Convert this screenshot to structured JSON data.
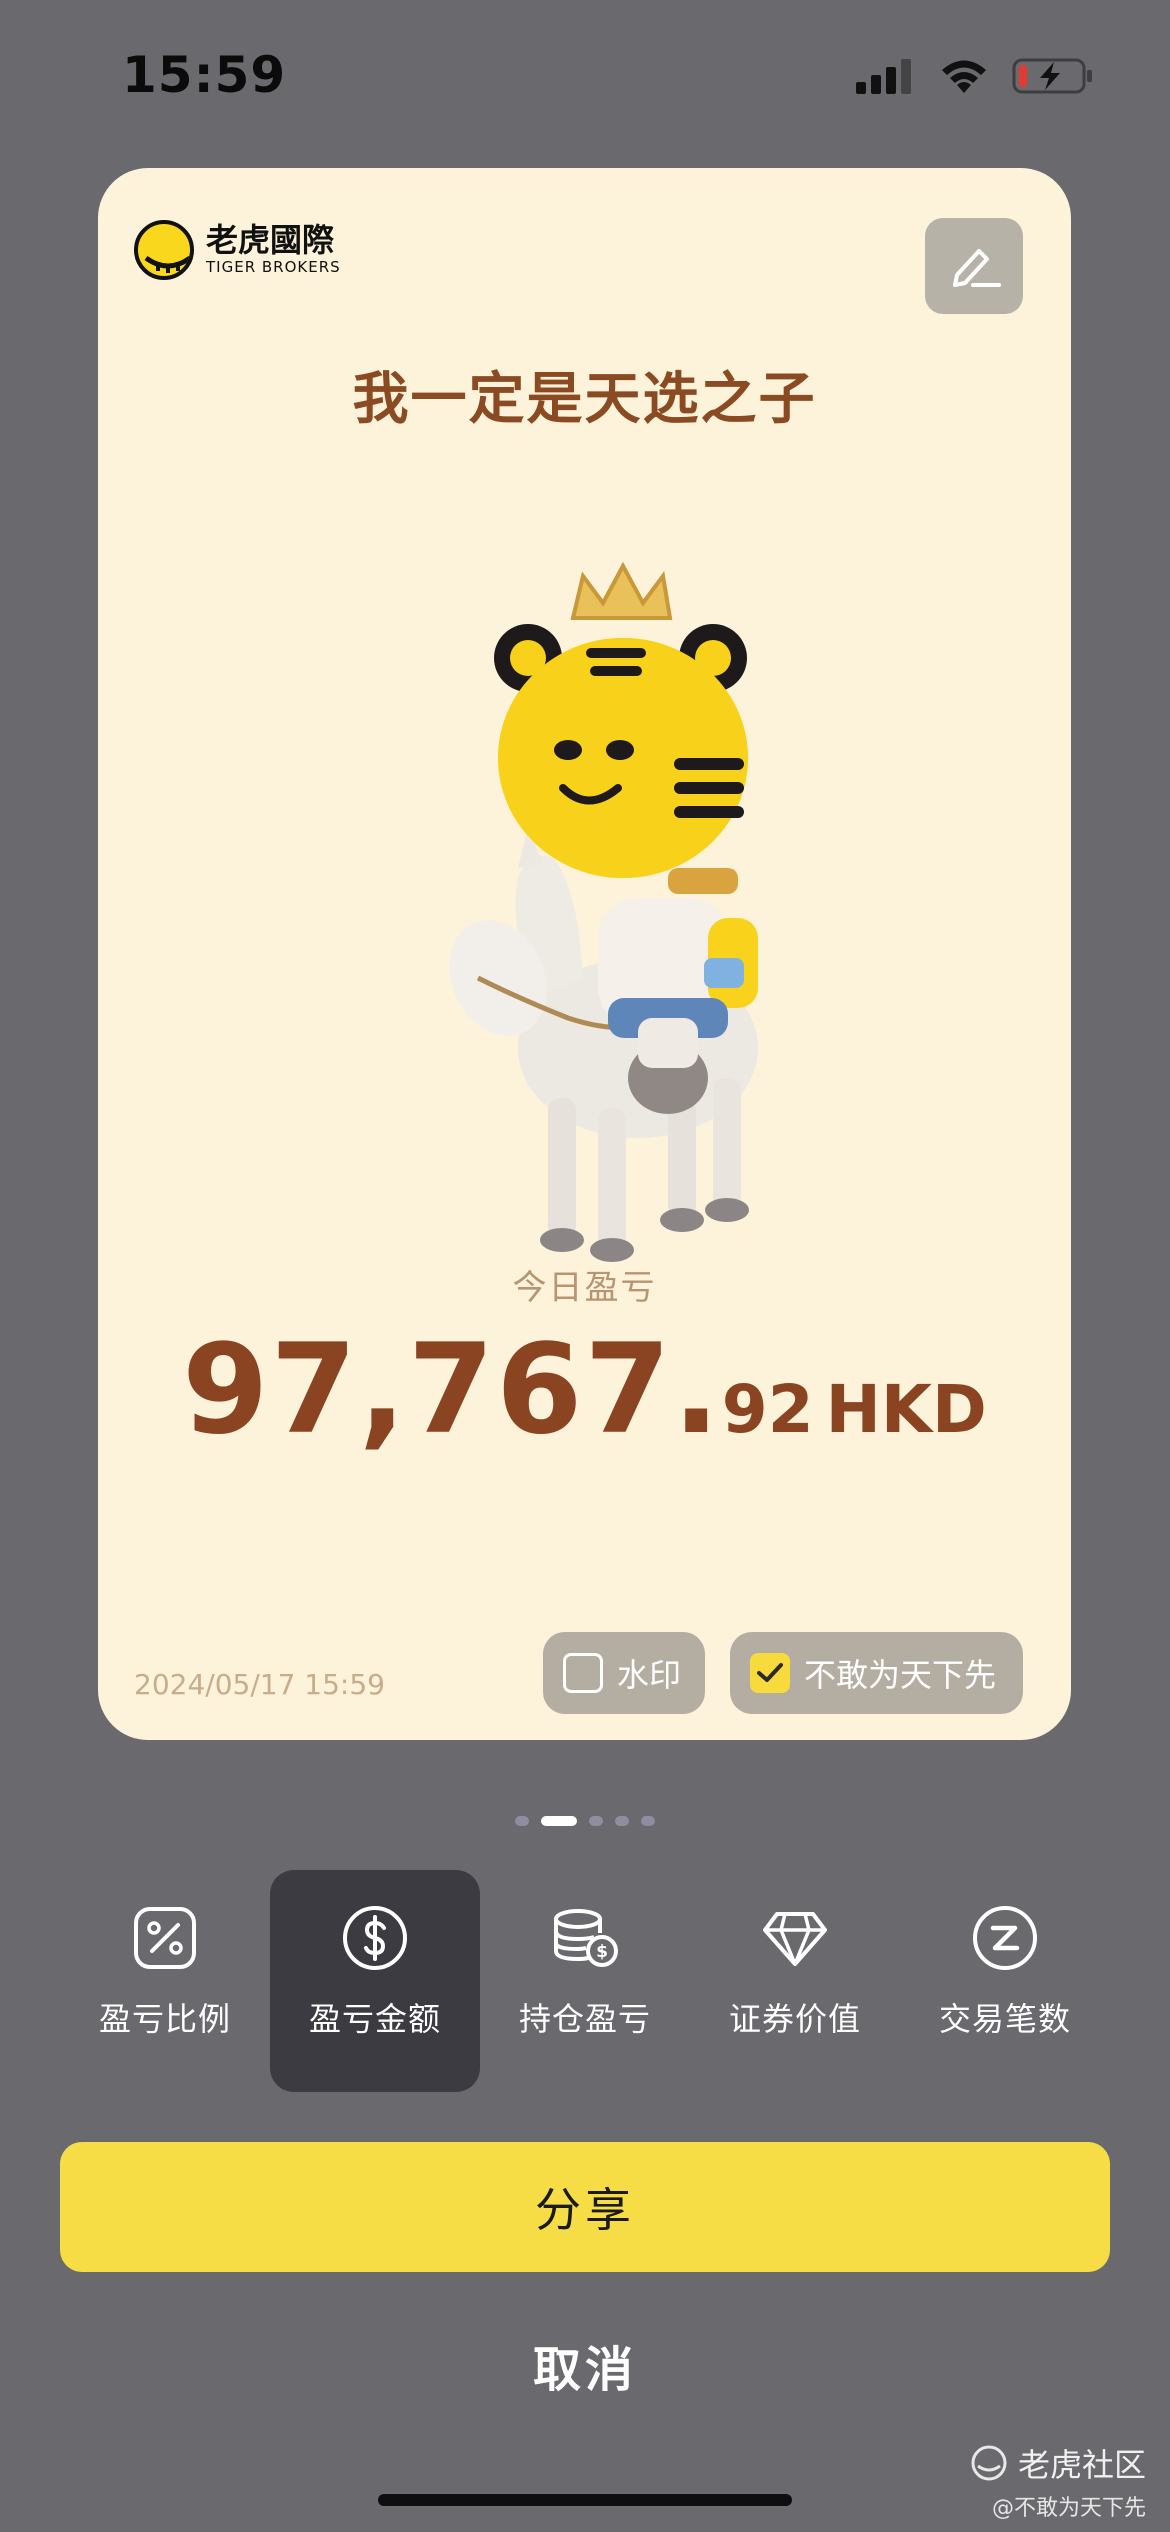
{
  "status_bar": {
    "time": "15:59"
  },
  "card": {
    "brand_cn": "老虎國際",
    "brand_en": "TIGER BROKERS",
    "title": "我一定是天选之子",
    "pnl_label": "今日盈亏",
    "pnl_value_int": "97,767.",
    "pnl_value_dec": "92",
    "pnl_currency": "HKD",
    "date": "2024/05/17 15:59",
    "watermark_label": "水印",
    "watermark_checked": false,
    "slogan_label": "不敢为天下先",
    "slogan_checked": true
  },
  "pagination": {
    "total": 5,
    "active": 1
  },
  "options": [
    {
      "label": "盈亏比例",
      "icon": "percent-icon",
      "selected": false
    },
    {
      "label": "盈亏金额",
      "icon": "dollar-icon",
      "selected": true
    },
    {
      "label": "持仓盈亏",
      "icon": "coins-stack-icon",
      "selected": false
    },
    {
      "label": "证券价值",
      "icon": "diamond-icon",
      "selected": false
    },
    {
      "label": "交易笔数",
      "icon": "z-circle-icon",
      "selected": false
    }
  ],
  "actions": {
    "share_label": "分享",
    "cancel_label": "取消"
  },
  "watermark_footer": {
    "community": "老虎社区",
    "user": "@不敢为天下先"
  },
  "colors": {
    "background": "#69696e",
    "card": "#fdf2da",
    "accent_yellow": "#f6dd46",
    "title_brown": "#8a4b22"
  }
}
